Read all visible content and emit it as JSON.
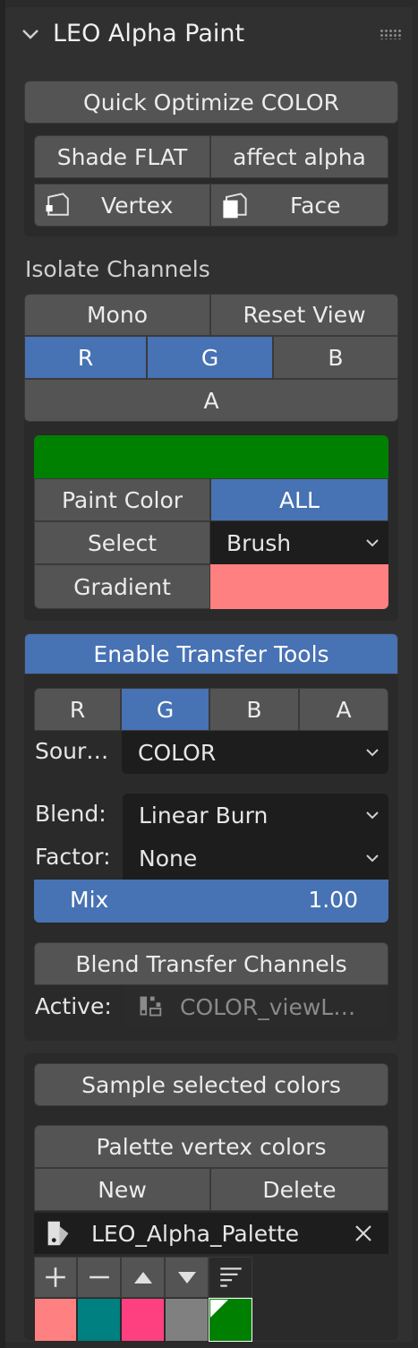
{
  "panel": {
    "title": "LEO Alpha Paint"
  },
  "optimize": {
    "quick_label": "Quick Optimize COLOR",
    "shade_flat_label": "Shade FLAT",
    "affect_alpha_label": "affect alpha",
    "vertex_label": "Vertex",
    "face_label": "Face"
  },
  "isolate": {
    "title": "Isolate Channels",
    "mono_label": "Mono",
    "reset_view_label": "Reset View",
    "channels": [
      "R",
      "G",
      "B"
    ],
    "alpha_label": "A",
    "active_channels": [
      "R",
      "G"
    ]
  },
  "paint": {
    "color": "#008000",
    "paint_color_label": "Paint Color",
    "all_label": "ALL",
    "select_label": "Select",
    "select_value": "Brush",
    "gradient_label": "Gradient",
    "gradient_color": "#ff8080"
  },
  "transfer": {
    "enable_label": "Enable Transfer Tools",
    "channels": [
      "R",
      "G",
      "B",
      "A"
    ],
    "active_channel": "G",
    "source_label": "Sour…",
    "source_value": "COLOR",
    "blend_label": "Blend:",
    "blend_value": "Linear Burn",
    "factor_label": "Factor:",
    "factor_value": "None",
    "mix_label": "Mix",
    "mix_value": "1.00",
    "blend_channels_label": "Blend Transfer Channels",
    "active_label": "Active:",
    "active_value": "COLOR_viewL…"
  },
  "palette": {
    "sample_label": "Sample selected colors",
    "palette_title": "Palette vertex colors",
    "new_label": "New",
    "delete_label": "Delete",
    "palette_name": "LEO_Alpha_Palette",
    "swatches": [
      "#ff8080",
      "#008080",
      "#ff4080",
      "#808080",
      "#008000"
    ]
  },
  "colors": {
    "accent": "#4772b3",
    "button": "#545454",
    "panel": "#303030",
    "field": "#1d1d1d"
  }
}
